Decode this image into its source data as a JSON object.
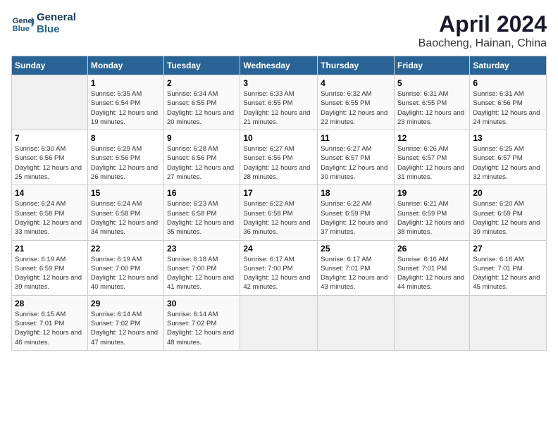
{
  "header": {
    "logo_line1": "General",
    "logo_line2": "Blue",
    "title": "April 2024",
    "location": "Baocheng, Hainan, China"
  },
  "days_of_week": [
    "Sunday",
    "Monday",
    "Tuesday",
    "Wednesday",
    "Thursday",
    "Friday",
    "Saturday"
  ],
  "weeks": [
    [
      {
        "day": "",
        "empty": true
      },
      {
        "day": "1",
        "sunrise": "6:35 AM",
        "sunset": "6:54 PM",
        "daylight": "12 hours and 19 minutes."
      },
      {
        "day": "2",
        "sunrise": "6:34 AM",
        "sunset": "6:55 PM",
        "daylight": "12 hours and 20 minutes."
      },
      {
        "day": "3",
        "sunrise": "6:33 AM",
        "sunset": "6:55 PM",
        "daylight": "12 hours and 21 minutes."
      },
      {
        "day": "4",
        "sunrise": "6:32 AM",
        "sunset": "6:55 PM",
        "daylight": "12 hours and 22 minutes."
      },
      {
        "day": "5",
        "sunrise": "6:31 AM",
        "sunset": "6:55 PM",
        "daylight": "12 hours and 23 minutes."
      },
      {
        "day": "6",
        "sunrise": "6:31 AM",
        "sunset": "6:56 PM",
        "daylight": "12 hours and 24 minutes."
      }
    ],
    [
      {
        "day": "7",
        "sunrise": "6:30 AM",
        "sunset": "6:56 PM",
        "daylight": "12 hours and 25 minutes."
      },
      {
        "day": "8",
        "sunrise": "6:29 AM",
        "sunset": "6:56 PM",
        "daylight": "12 hours and 26 minutes."
      },
      {
        "day": "9",
        "sunrise": "6:28 AM",
        "sunset": "6:56 PM",
        "daylight": "12 hours and 27 minutes."
      },
      {
        "day": "10",
        "sunrise": "6:27 AM",
        "sunset": "6:56 PM",
        "daylight": "12 hours and 28 minutes."
      },
      {
        "day": "11",
        "sunrise": "6:27 AM",
        "sunset": "6:57 PM",
        "daylight": "12 hours and 30 minutes."
      },
      {
        "day": "12",
        "sunrise": "6:26 AM",
        "sunset": "6:57 PM",
        "daylight": "12 hours and 31 minutes."
      },
      {
        "day": "13",
        "sunrise": "6:25 AM",
        "sunset": "6:57 PM",
        "daylight": "12 hours and 32 minutes."
      }
    ],
    [
      {
        "day": "14",
        "sunrise": "6:24 AM",
        "sunset": "6:58 PM",
        "daylight": "12 hours and 33 minutes."
      },
      {
        "day": "15",
        "sunrise": "6:24 AM",
        "sunset": "6:58 PM",
        "daylight": "12 hours and 34 minutes."
      },
      {
        "day": "16",
        "sunrise": "6:23 AM",
        "sunset": "6:58 PM",
        "daylight": "12 hours and 35 minutes."
      },
      {
        "day": "17",
        "sunrise": "6:22 AM",
        "sunset": "6:58 PM",
        "daylight": "12 hours and 36 minutes."
      },
      {
        "day": "18",
        "sunrise": "6:22 AM",
        "sunset": "6:59 PM",
        "daylight": "12 hours and 37 minutes."
      },
      {
        "day": "19",
        "sunrise": "6:21 AM",
        "sunset": "6:59 PM",
        "daylight": "12 hours and 38 minutes."
      },
      {
        "day": "20",
        "sunrise": "6:20 AM",
        "sunset": "6:59 PM",
        "daylight": "12 hours and 39 minutes."
      }
    ],
    [
      {
        "day": "21",
        "sunrise": "6:19 AM",
        "sunset": "6:59 PM",
        "daylight": "12 hours and 39 minutes."
      },
      {
        "day": "22",
        "sunrise": "6:19 AM",
        "sunset": "7:00 PM",
        "daylight": "12 hours and 40 minutes."
      },
      {
        "day": "23",
        "sunrise": "6:18 AM",
        "sunset": "7:00 PM",
        "daylight": "12 hours and 41 minutes."
      },
      {
        "day": "24",
        "sunrise": "6:17 AM",
        "sunset": "7:00 PM",
        "daylight": "12 hours and 42 minutes."
      },
      {
        "day": "25",
        "sunrise": "6:17 AM",
        "sunset": "7:01 PM",
        "daylight": "12 hours and 43 minutes."
      },
      {
        "day": "26",
        "sunrise": "6:16 AM",
        "sunset": "7:01 PM",
        "daylight": "12 hours and 44 minutes."
      },
      {
        "day": "27",
        "sunrise": "6:16 AM",
        "sunset": "7:01 PM",
        "daylight": "12 hours and 45 minutes."
      }
    ],
    [
      {
        "day": "28",
        "sunrise": "6:15 AM",
        "sunset": "7:01 PM",
        "daylight": "12 hours and 46 minutes."
      },
      {
        "day": "29",
        "sunrise": "6:14 AM",
        "sunset": "7:02 PM",
        "daylight": "12 hours and 47 minutes."
      },
      {
        "day": "30",
        "sunrise": "6:14 AM",
        "sunset": "7:02 PM",
        "daylight": "12 hours and 48 minutes."
      },
      {
        "day": "",
        "empty": true
      },
      {
        "day": "",
        "empty": true
      },
      {
        "day": "",
        "empty": true
      },
      {
        "day": "",
        "empty": true
      }
    ]
  ]
}
